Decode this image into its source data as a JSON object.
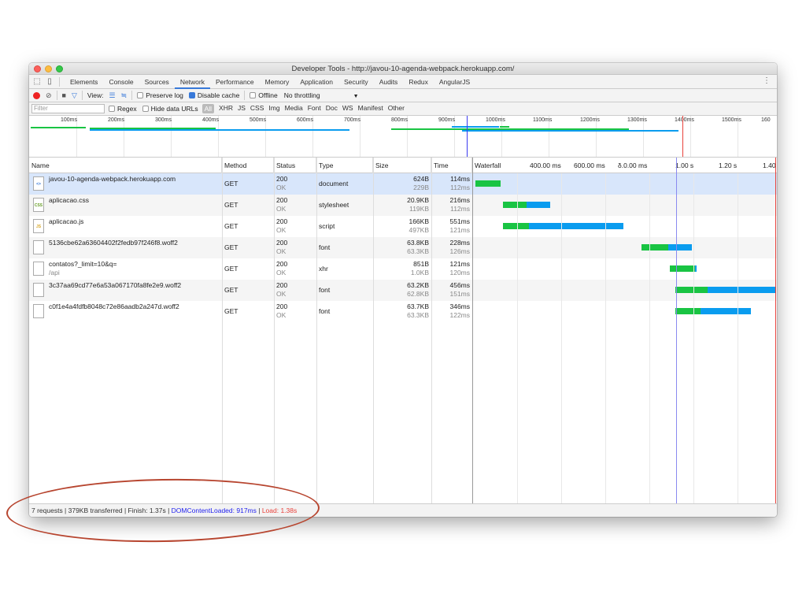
{
  "window": {
    "title": "Developer Tools - http://javou-10-agenda-webpack.herokuapp.com/"
  },
  "tabs": [
    "Elements",
    "Console",
    "Sources",
    "Network",
    "Performance",
    "Memory",
    "Application",
    "Security",
    "Audits",
    "Redux",
    "AngularJS"
  ],
  "active_tab": "Network",
  "toolbar": {
    "view_label": "View:",
    "preserve_log": "Preserve log",
    "disable_cache": "Disable cache",
    "offline": "Offline",
    "throttling": "No throttling"
  },
  "filter": {
    "placeholder": "Filter",
    "regex": "Regex",
    "hide_data_urls": "Hide data URLs",
    "types": [
      "All",
      "XHR",
      "JS",
      "CSS",
      "Img",
      "Media",
      "Font",
      "Doc",
      "WS",
      "Manifest",
      "Other"
    ]
  },
  "overview": {
    "ticks": [
      "100ms",
      "200ms",
      "300ms",
      "400ms",
      "500ms",
      "600ms",
      "700ms",
      "800ms",
      "900ms",
      "1000ms",
      "1100ms",
      "1200ms",
      "1300ms",
      "1400ms",
      "1500ms",
      "160"
    ]
  },
  "columns": {
    "name": "Name",
    "method": "Method",
    "status": "Status",
    "type": "Type",
    "size": "Size",
    "time": "Time",
    "waterfall": "Waterfall"
  },
  "waterfall_ticks": [
    "400.00 ms",
    "600.00 ms",
    "δ.0.00 ms",
    "1.00 s",
    "1.20 s",
    "1.40"
  ],
  "rows": [
    {
      "icon": "doc",
      "name": "javou-10-agenda-webpack.herokuapp.com",
      "sub": "",
      "method": "GET",
      "status": "200",
      "status_text": "OK",
      "type": "document",
      "size": "624B",
      "size2": "229B",
      "time": "114ms",
      "time2": "112ms",
      "selected": true
    },
    {
      "icon": "css",
      "name": "aplicacao.css",
      "sub": "",
      "method": "GET",
      "status": "200",
      "status_text": "OK",
      "type": "stylesheet",
      "size": "20.9KB",
      "size2": "119KB",
      "time": "216ms",
      "time2": "112ms",
      "selected": false
    },
    {
      "icon": "js",
      "name": "aplicacao.js",
      "sub": "",
      "method": "GET",
      "status": "200",
      "status_text": "OK",
      "type": "script",
      "size": "166KB",
      "size2": "497KB",
      "time": "551ms",
      "time2": "121ms",
      "selected": false
    },
    {
      "icon": "blank",
      "name": "5136cbe62a63604402f2fedb97f246f8.woff2",
      "sub": "",
      "method": "GET",
      "status": "200",
      "status_text": "OK",
      "type": "font",
      "size": "63.8KB",
      "size2": "63.3KB",
      "time": "228ms",
      "time2": "126ms",
      "selected": false
    },
    {
      "icon": "blank",
      "name": "contatos?_limit=10&q=",
      "sub": "/api",
      "method": "GET",
      "status": "200",
      "status_text": "OK",
      "type": "xhr",
      "size": "851B",
      "size2": "1.0KB",
      "time": "121ms",
      "time2": "120ms",
      "selected": false
    },
    {
      "icon": "blank",
      "name": "3c37aa69cd77e6a53a067170fa8fe2e9.woff2",
      "sub": "",
      "method": "GET",
      "status": "200",
      "status_text": "OK",
      "type": "font",
      "size": "63.2KB",
      "size2": "62.8KB",
      "time": "456ms",
      "time2": "151ms",
      "selected": false
    },
    {
      "icon": "blank",
      "name": "c0f1e4a4fdfb8048c72e86aadb2a247d.woff2",
      "sub": "",
      "method": "GET",
      "status": "200",
      "status_text": "OK",
      "type": "font",
      "size": "63.7KB",
      "size2": "63.3KB",
      "time": "346ms",
      "time2": "122ms",
      "selected": false
    }
  ],
  "status": {
    "summary": "7 requests | 379KB transferred | Finish: 1.37s | ",
    "dom": "DOMContentLoaded: 917ms",
    "divider": " | ",
    "load": "Load: 1.38s"
  },
  "colors": {
    "waiting": "#19c443",
    "download": "#0a9cef",
    "dom_line": "#3a3af0",
    "load_line": "#e8413b"
  }
}
